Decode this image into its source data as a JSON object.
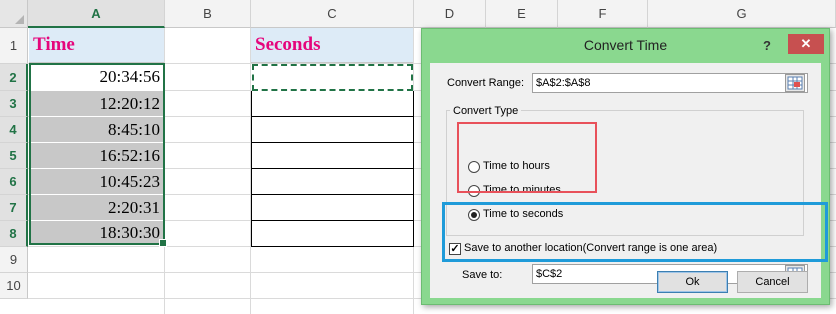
{
  "sheet": {
    "columns": [
      "A",
      "B",
      "C",
      "D",
      "E",
      "F",
      "G"
    ],
    "rows": [
      "1",
      "2",
      "3",
      "4",
      "5",
      "6",
      "7",
      "8",
      "9",
      "10"
    ],
    "time_header": "Time",
    "seconds_header": "Seconds",
    "times": [
      "20:34:56",
      "12:20:12",
      "8:45:10",
      "16:52:16",
      "10:45:23",
      "2:20:31",
      "18:30:30"
    ]
  },
  "dialog": {
    "title": "Convert Time",
    "help": "?",
    "close": "✕",
    "convert_range_label": "Convert Range:",
    "convert_range_value": "$A$2:$A$8",
    "convert_type_label": "Convert Type",
    "options": [
      "Time to hours",
      "Time to minutes",
      "Time to seconds"
    ],
    "selected_option": "Time to seconds",
    "save_checkbox_label": "Save to another location(Convert range is one area)",
    "save_checkbox_checked": true,
    "save_to_label": "Save to:",
    "save_to_value": "$C$2",
    "ok_label": "Ok",
    "cancel_label": "Cancel"
  },
  "colors": {
    "header_text": "#e5057c",
    "header_fill": "#ddebf7",
    "selection": "#217346",
    "dialog_frame": "#8ad88f",
    "highlight_red": "#e8515a",
    "highlight_blue": "#1f9bd9"
  }
}
